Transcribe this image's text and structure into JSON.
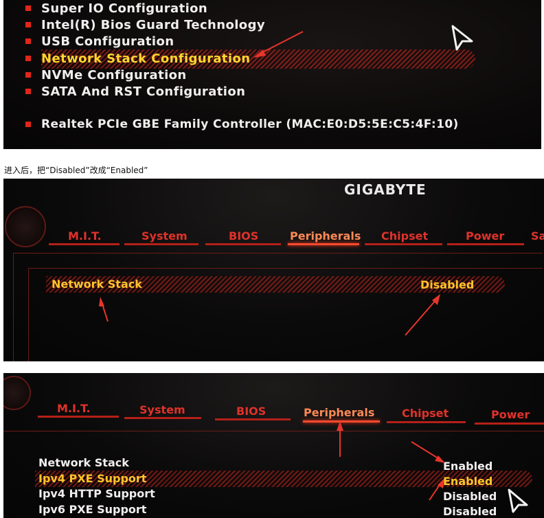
{
  "panel1": {
    "menu_items": [
      {
        "label": "Super IO Configuration"
      },
      {
        "label": "Intel(R) Bios Guard Technology"
      },
      {
        "label": "USB Configuration"
      },
      {
        "label": "Network Stack Configuration"
      },
      {
        "label": "NVMe Configuration"
      },
      {
        "label": "SATA And RST Configuration"
      },
      {
        "label": "Realtek PCIe GBE Family Controller (MAC:E0:D5:5E:C5:4F:10)"
      }
    ],
    "selected_index": 3
  },
  "caption": "进入后，把“Disabled”改成“Enabled”",
  "panel2": {
    "brand": "GIGABYTE",
    "tabs": [
      "M.I.T.",
      "System",
      "BIOS",
      "Peripherals",
      "Chipset",
      "Power",
      "Sa"
    ],
    "active_tab": "Peripherals",
    "setting": {
      "label": "Network Stack",
      "value": "Disabled"
    }
  },
  "panel3": {
    "tabs": [
      "M.I.T.",
      "System",
      "BIOS",
      "Peripherals",
      "Chipset",
      "Power"
    ],
    "active_tab": "Peripherals",
    "settings": [
      {
        "label": "Network Stack",
        "value": "Enabled"
      },
      {
        "label": "Ipv4 PXE Support",
        "value": "Enabled"
      },
      {
        "label": "Ipv4 HTTP Support",
        "value": "Disabled"
      },
      {
        "label": "Ipv6 PXE Support",
        "value": "Disabled"
      }
    ],
    "selected_index": 1
  },
  "colors": {
    "accent_red": "#e32519",
    "highlight_text": "#ffd72d",
    "annotation_arrow": "#e8352b"
  }
}
